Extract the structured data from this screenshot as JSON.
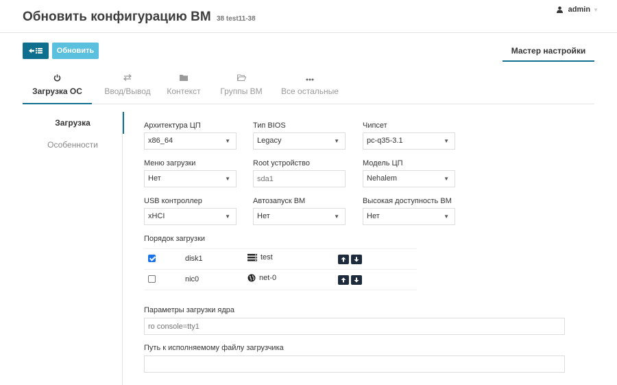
{
  "header": {
    "title": "Обновить конфигурацию ВМ",
    "subtitle": "38 test11-38",
    "user": "admin"
  },
  "toolbar": {
    "update_label": "Обновить",
    "wizard_label": "Мастер настройки"
  },
  "tabs": [
    {
      "label": "Загрузка ОС",
      "icon": "power-icon",
      "active": true
    },
    {
      "label": "Ввод/Вывод",
      "icon": "exchange-icon",
      "active": false
    },
    {
      "label": "Контекст",
      "icon": "folder-icon",
      "active": false
    },
    {
      "label": "Группы ВМ",
      "icon": "folder-open-icon",
      "active": false
    },
    {
      "label": "Все остальные",
      "icon": "ellipsis-icon",
      "active": false
    }
  ],
  "side_nav": [
    {
      "label": "Загрузка",
      "active": true
    },
    {
      "label": "Особенности",
      "active": false
    }
  ],
  "form": {
    "cpu_arch": {
      "label": "Архитектура ЦП",
      "value": "x86_64"
    },
    "bios_type": {
      "label": "Тип BIOS",
      "value": "Legacy"
    },
    "chipset": {
      "label": "Чипсет",
      "value": "pc-q35-3.1"
    },
    "boot_menu": {
      "label": "Меню загрузки",
      "value": "Нет"
    },
    "root_device": {
      "label": "Root устройство",
      "placeholder": "sda1"
    },
    "cpu_model": {
      "label": "Модель ЦП",
      "value": "Nehalem"
    },
    "usb_controller": {
      "label": "USB контроллер",
      "value": "xHCI"
    },
    "autostart": {
      "label": "Автозапуск ВМ",
      "value": "Нет"
    },
    "high_availability": {
      "label": "Высокая доступность ВМ",
      "value": "Нет"
    },
    "kernel_params": {
      "label": "Параметры загрузки ядра",
      "placeholder": "ro console=tty1"
    },
    "bootloader_path": {
      "label": "Путь к исполняемому файлу загрузчика",
      "placeholder": ""
    }
  },
  "boot_order": {
    "label": "Порядок загрузки",
    "rows": [
      {
        "checked": true,
        "name": "disk1",
        "target": "test",
        "icon": "disk-icon"
      },
      {
        "checked": false,
        "name": "nic0",
        "target": "net-0",
        "icon": "globe-icon"
      }
    ]
  },
  "colors": {
    "primary": "#0f6f8f",
    "info": "#5bc0de",
    "dark_button": "#1e2b3c"
  }
}
